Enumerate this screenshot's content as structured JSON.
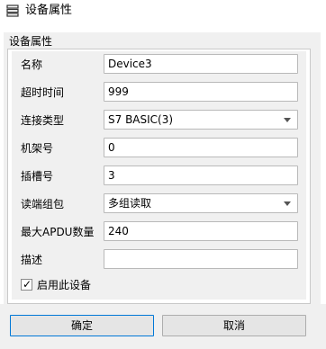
{
  "window": {
    "title": "设备属性",
    "icon": "list-icon"
  },
  "group": {
    "title": "设备属性"
  },
  "fields": {
    "name": {
      "label": "名称",
      "value": "Device3"
    },
    "timeout": {
      "label": "超时时间",
      "value": "999"
    },
    "connection_type": {
      "label": "连接类型",
      "value": "S7 BASIC(3)"
    },
    "rack": {
      "label": "机架号",
      "value": "0"
    },
    "slot": {
      "label": "插槽号",
      "value": "3"
    },
    "read_grouping": {
      "label": "读端组包",
      "value": "多组读取"
    },
    "max_apdu": {
      "label": "最大APDU数量",
      "value": "240"
    },
    "description": {
      "label": "描述",
      "value": ""
    }
  },
  "enable": {
    "label": "启用此设备",
    "checked": true,
    "mark": "✓"
  },
  "buttons": {
    "ok": "确定",
    "cancel": "取消"
  },
  "colors": {
    "accent_border": "#0078d7",
    "panel_bg": "#f0f0f0"
  }
}
